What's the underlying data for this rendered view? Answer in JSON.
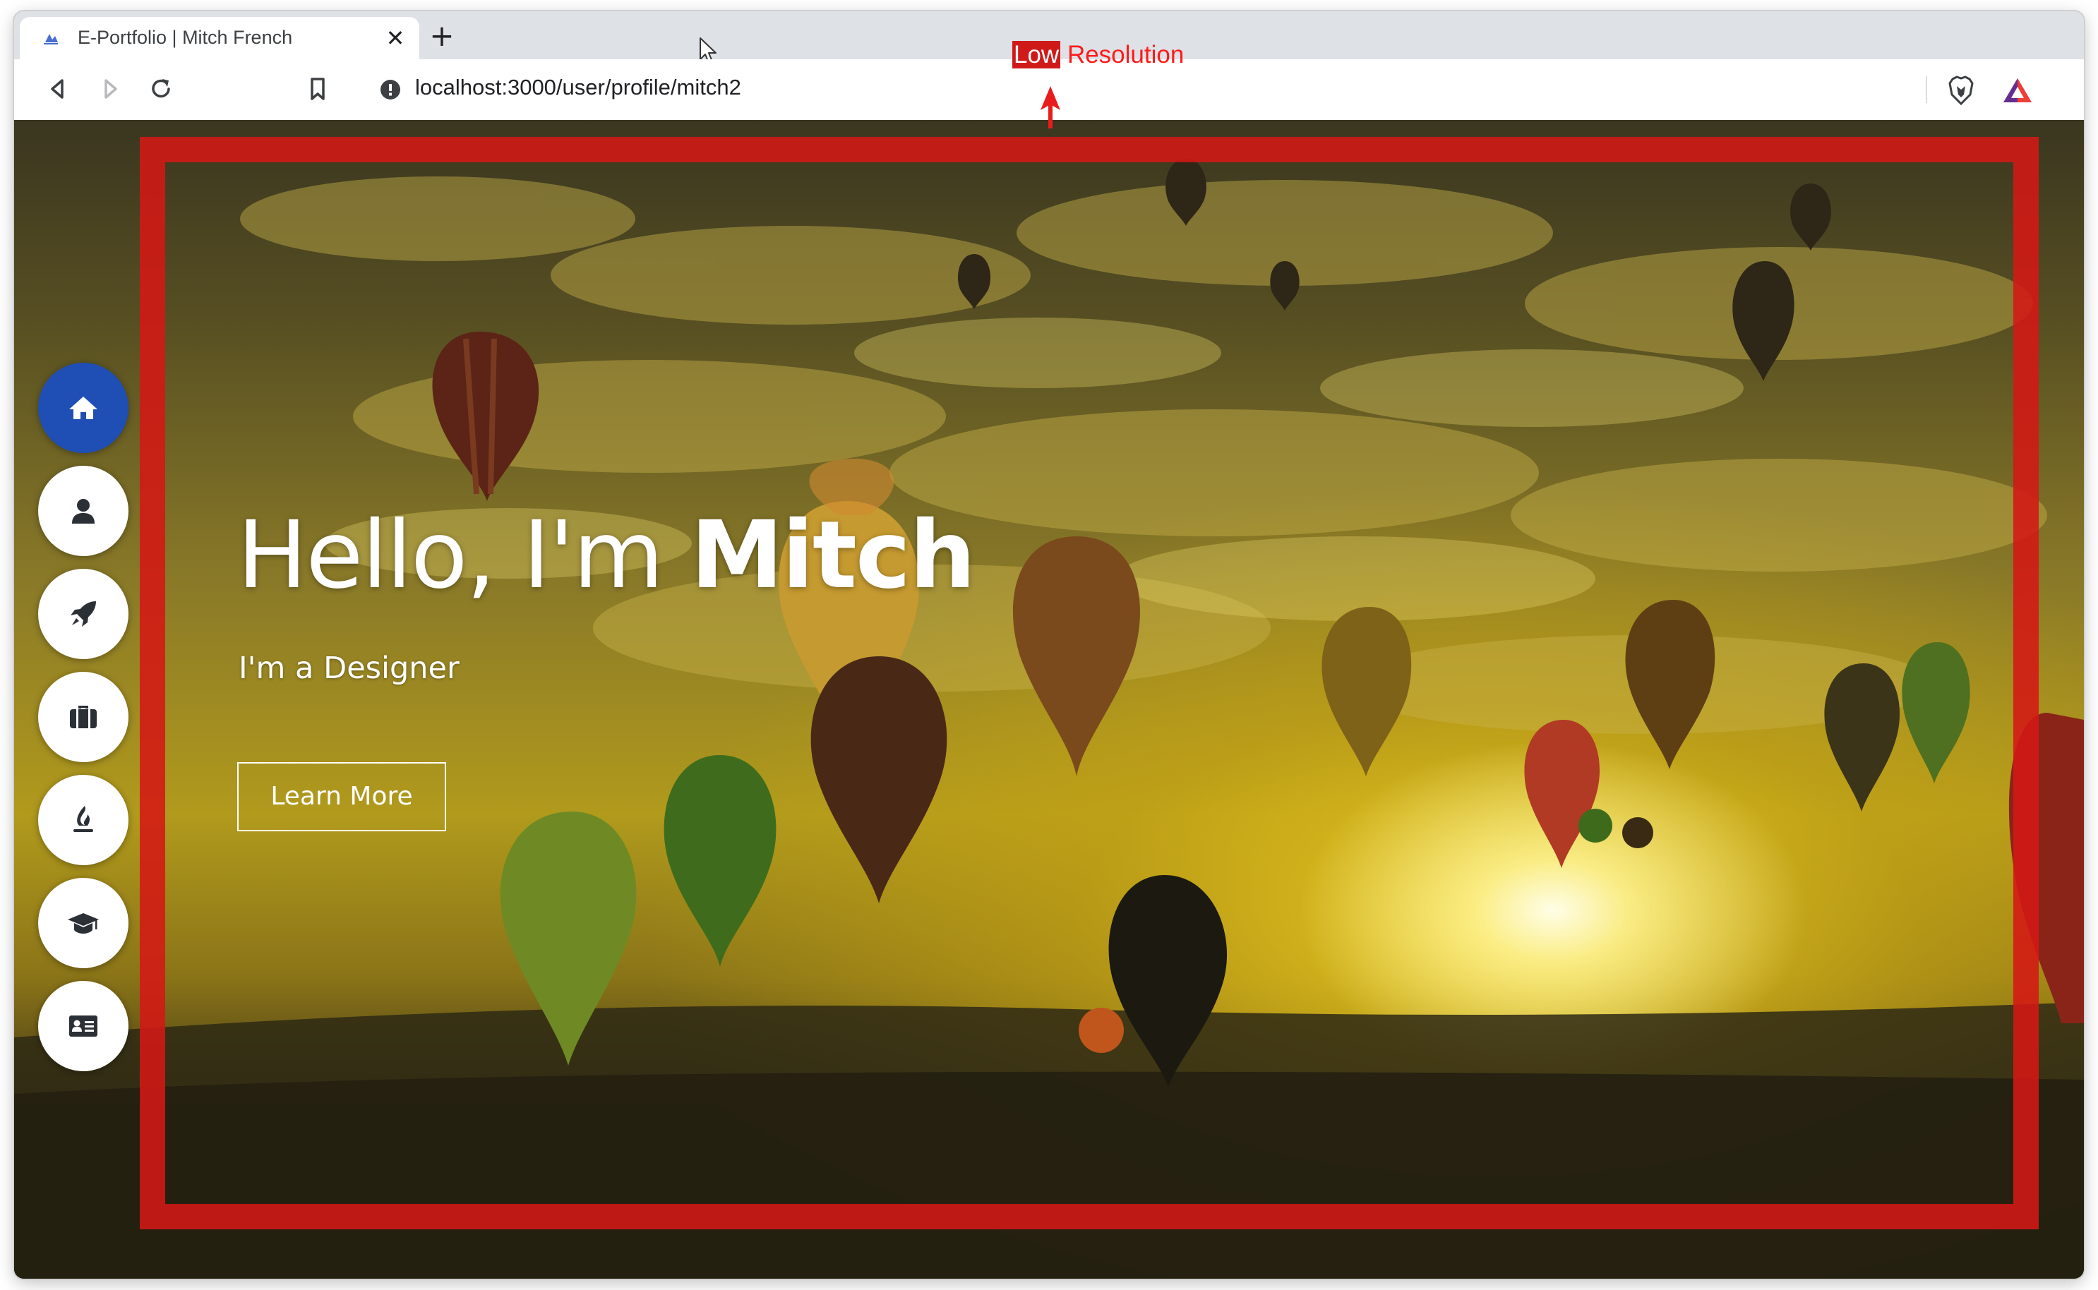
{
  "browser": {
    "tab_title": "E-Portfolio | Mitch French",
    "close_glyph": "✕",
    "new_tab_glyph": "+",
    "url": "localhost:3000/user/profile/mitch2"
  },
  "annotation": {
    "low": "Low",
    "resolution": " Resolution",
    "color": "#ff1a1a"
  },
  "hero": {
    "greeting": "Hello, I'm ",
    "name": "Mitch",
    "subtitle": "I'm a Designer",
    "button_label": "Learn More"
  },
  "sidebar": {
    "items": [
      {
        "icon": "home-icon",
        "active": true
      },
      {
        "icon": "user-icon",
        "active": false
      },
      {
        "icon": "rocket-icon",
        "active": false
      },
      {
        "icon": "briefcase-icon",
        "active": false
      },
      {
        "icon": "fire-icon",
        "active": false
      },
      {
        "icon": "graduation-cap-icon",
        "active": false
      },
      {
        "icon": "contact-card-icon",
        "active": false
      }
    ],
    "active_color": "#1f4fb4"
  },
  "frame_color": "#d41814"
}
